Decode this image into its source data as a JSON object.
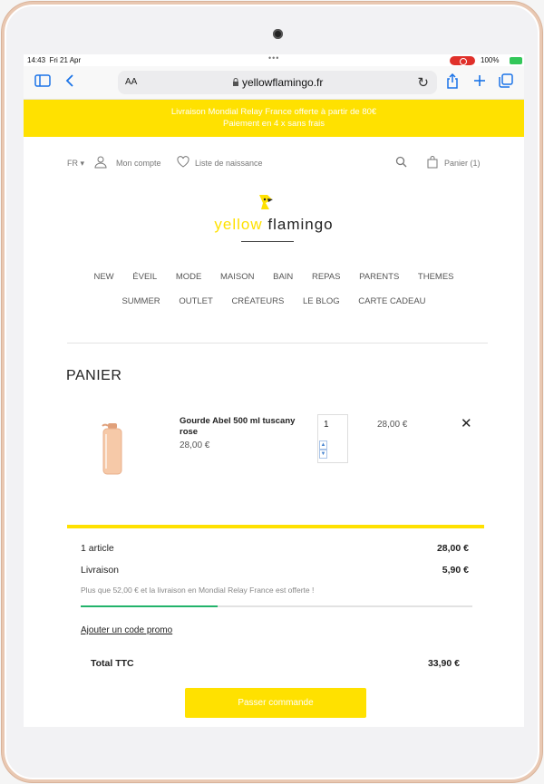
{
  "status": {
    "time": "14:43",
    "date": "Fri 21 Apr",
    "dots": "•••",
    "battery": "100%"
  },
  "browser": {
    "aa": "AA",
    "url": "yellowflamingo.fr",
    "reload": "↻"
  },
  "promo": {
    "line1": "Livraison Mondial Relay France offerte à partir de 80€",
    "line2": "Paiement en 4 x sans frais"
  },
  "header": {
    "lang": "FR",
    "account": "Mon compte",
    "wishlist": "Liste de naissance",
    "cart": "Panier (1)"
  },
  "logo": {
    "yellow": "yellow",
    "flamingo": "flamingo"
  },
  "menu": {
    "row1": [
      "NEW",
      "ÉVEIL",
      "MODE",
      "MAISON",
      "BAIN",
      "REPAS",
      "PARENTS",
      "THEMES"
    ],
    "row2": [
      "SUMMER",
      "OUTLET",
      "CRÉATEURS",
      "LE BLOG",
      "CARTE CADEAU"
    ]
  },
  "cart": {
    "title": "PANIER",
    "item": {
      "name": "Gourde Abel 500 ml tuscany rose",
      "unit_price": "28,00 €",
      "quantity": "1",
      "total": "28,00 €"
    }
  },
  "summary": {
    "articles_label": "1 article",
    "articles_value": "28,00 €",
    "shipping_label": "Livraison",
    "shipping_value": "5,90 €",
    "free_shipping_note": "Plus que 52,00 € et la livraison en Mondial Relay France est offerte !",
    "free_shipping_progress": 0.35,
    "promo_link": "Ajouter un code promo",
    "total_label": "Total TTC",
    "total_value": "33,90 €",
    "checkout": "Passer commande"
  },
  "colors": {
    "brand_yellow": "#ffe100",
    "progress_green": "#22b36b",
    "browser_blue": "#1a73e8"
  }
}
